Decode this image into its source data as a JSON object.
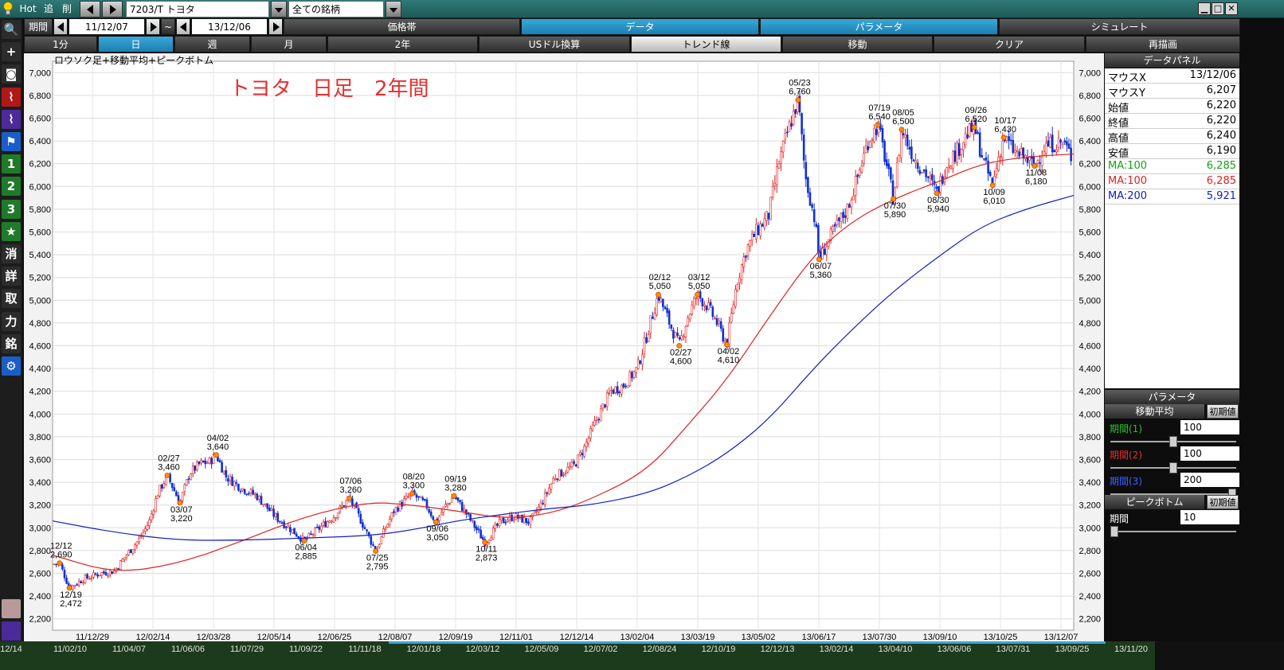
{
  "topbar": {
    "hot_label": "Hot",
    "add_label": "追",
    "del_label": "削",
    "symbol_value": "7203/T トヨタ",
    "universe_value": "全ての銘柄",
    "window_min": "▁",
    "window_max": "□",
    "window_close": "✕"
  },
  "period_row": {
    "period_label": "期間",
    "from_date": "11/12/07",
    "tilde": "~",
    "to_date": "13/12/06",
    "tabs": [
      "価格帯",
      "データ",
      "パラメータ",
      "シミュレート"
    ]
  },
  "span_row": {
    "tabs": [
      "1分",
      "日",
      "週",
      "月",
      "2年",
      "USドル換算",
      "トレンド線",
      "移動",
      "クリア",
      "再描画"
    ],
    "active_index": 1
  },
  "left_tools": [
    {
      "name": "zoom-icon",
      "glyph": "🔍",
      "style": "dark"
    },
    {
      "name": "crosshair-icon",
      "glyph": "+",
      "style": "dark"
    },
    {
      "name": "camera-icon",
      "glyph": "◙",
      "style": "dark"
    },
    {
      "name": "chart-line-icon",
      "glyph": "⌇",
      "style": "red"
    },
    {
      "name": "chart-multi-icon",
      "glyph": "⌇",
      "style": "purple"
    },
    {
      "name": "flag-icon",
      "glyph": "⚑",
      "style": "blue"
    },
    {
      "name": "preset-1-icon",
      "glyph": "1",
      "style": "green"
    },
    {
      "name": "preset-2-icon",
      "glyph": "2",
      "style": "green"
    },
    {
      "name": "preset-3-icon",
      "glyph": "3",
      "style": "green"
    },
    {
      "name": "star-icon",
      "glyph": "★",
      "style": "green"
    },
    {
      "name": "erase-icon",
      "glyph": "消",
      "style": "dark"
    },
    {
      "name": "detail-icon",
      "glyph": "詳",
      "style": "dark"
    },
    {
      "name": "take-icon",
      "glyph": "取",
      "style": "dark"
    },
    {
      "name": "power-icon",
      "glyph": "力",
      "style": "dark"
    },
    {
      "name": "stock-icon",
      "glyph": "銘",
      "style": "dark"
    },
    {
      "name": "settings-icon",
      "glyph": "⚙",
      "style": "blue"
    }
  ],
  "chart_header": {
    "label": "ロウソク足+移動平均+ピークボトム",
    "overlay_title": "トヨタ　日足　2年間"
  },
  "chart_data": {
    "type": "line",
    "title": "トヨタ　日足　2年間",
    "ylim": [
      2100,
      7100
    ],
    "yticks": [
      2200,
      2400,
      2600,
      2800,
      3000,
      3200,
      3400,
      3600,
      3800,
      4000,
      4200,
      4400,
      4600,
      4800,
      5000,
      5200,
      5400,
      5600,
      5800,
      6000,
      6200,
      6400,
      6600,
      6800,
      7000
    ],
    "x_tick_labels": [
      "11/12/29",
      "12/02/14",
      "12/03/28",
      "12/05/14",
      "12/06/25",
      "12/08/07",
      "12/09/19",
      "12/11/01",
      "12/12/14",
      "13/02/04",
      "13/03/19",
      "13/05/02",
      "13/06/17",
      "13/07/30",
      "13/09/10",
      "13/10/25",
      "13/12/07"
    ],
    "bottom_strip_labels": [
      "12/14",
      "11/02/10",
      "11/04/07",
      "11/06/06",
      "11/07/29",
      "11/09/22",
      "11/11/18",
      "12/01/18",
      "12/03/12",
      "12/05/09",
      "12/07/02",
      "12/08/24",
      "12/10/19",
      "12/12/13",
      "13/02/14",
      "13/04/10",
      "13/06/06",
      "13/07/31",
      "13/09/25",
      "13/11/20"
    ],
    "x_range": [
      "11/12/07",
      "13/12/06"
    ],
    "price_path": [
      [
        "11/12/07",
        2680
      ],
      [
        "11/12/12",
        2690
      ],
      [
        "11/12/19",
        2472
      ],
      [
        "11/12/29",
        2550
      ],
      [
        "12/01/10",
        2600
      ],
      [
        "12/01/20",
        2620
      ],
      [
        "12/01/30",
        2780
      ],
      [
        "12/02/07",
        2900
      ],
      [
        "12/02/14",
        3050
      ],
      [
        "12/02/20",
        3300
      ],
      [
        "12/02/27",
        3460
      ],
      [
        "12/03/07",
        3220
      ],
      [
        "12/03/14",
        3480
      ],
      [
        "12/03/21",
        3560
      ],
      [
        "12/03/28",
        3580
      ],
      [
        "12/04/02",
        3640
      ],
      [
        "12/04/09",
        3450
      ],
      [
        "12/04/20",
        3350
      ],
      [
        "12/05/01",
        3280
      ],
      [
        "12/05/14",
        3100
      ],
      [
        "12/05/24",
        3000
      ],
      [
        "12/06/04",
        2885
      ],
      [
        "12/06/15",
        3000
      ],
      [
        "12/06/25",
        3100
      ],
      [
        "12/07/06",
        3260
      ],
      [
        "12/07/13",
        3100
      ],
      [
        "12/07/25",
        2795
      ],
      [
        "12/08/01",
        3000
      ],
      [
        "12/08/07",
        3150
      ],
      [
        "12/08/20",
        3300
      ],
      [
        "12/08/30",
        3200
      ],
      [
        "12/09/06",
        3050
      ],
      [
        "12/09/12",
        3180
      ],
      [
        "12/09/19",
        3280
      ],
      [
        "12/09/28",
        3120
      ],
      [
        "12/10/11",
        2873
      ],
      [
        "12/10/22",
        3050
      ],
      [
        "12/11/01",
        3100
      ],
      [
        "12/11/12",
        3050
      ],
      [
        "12/11/20",
        3200
      ],
      [
        "12/11/30",
        3450
      ],
      [
        "12/12/07",
        3500
      ],
      [
        "12/12/14",
        3550
      ],
      [
        "12/12/21",
        3700
      ],
      [
        "12/12/28",
        3900
      ],
      [
        "13/01/09",
        4200
      ],
      [
        "13/01/18",
        4250
      ],
      [
        "13/01/28",
        4400
      ],
      [
        "13/02/04",
        4700
      ],
      [
        "13/02/12",
        5050
      ],
      [
        "13/02/20",
        4800
      ],
      [
        "13/02/27",
        4600
      ],
      [
        "13/03/05",
        4850
      ],
      [
        "13/03/12",
        5050
      ],
      [
        "13/03/19",
        4950
      ],
      [
        "13/03/26",
        4800
      ],
      [
        "13/04/02",
        4610
      ],
      [
        "13/04/09",
        5150
      ],
      [
        "13/04/16",
        5450
      ],
      [
        "13/04/23",
        5600
      ],
      [
        "13/05/02",
        5750
      ],
      [
        "13/05/09",
        6200
      ],
      [
        "13/05/16",
        6500
      ],
      [
        "13/05/23",
        6760
      ],
      [
        "13/05/28",
        6100
      ],
      [
        "13/06/04",
        5700
      ],
      [
        "13/06/07",
        5360
      ],
      [
        "13/06/17",
        5600
      ],
      [
        "13/06/27",
        5800
      ],
      [
        "13/07/05",
        6100
      ],
      [
        "13/07/12",
        6400
      ],
      [
        "13/07/19",
        6540
      ],
      [
        "13/07/25",
        6200
      ],
      [
        "13/07/30",
        5890
      ],
      [
        "13/08/05",
        6500
      ],
      [
        "13/08/14",
        6250
      ],
      [
        "13/08/23",
        6100
      ],
      [
        "13/08/30",
        5940
      ],
      [
        "13/09/06",
        6200
      ],
      [
        "13/09/13",
        6300
      ],
      [
        "13/09/20",
        6450
      ],
      [
        "13/09/26",
        6520
      ],
      [
        "13/10/03",
        6200
      ],
      [
        "13/10/09",
        6010
      ],
      [
        "13/10/14",
        6300
      ],
      [
        "13/10/17",
        6430
      ],
      [
        "13/10/25",
        6300
      ],
      [
        "13/11/01",
        6250
      ],
      [
        "13/11/08",
        6180
      ],
      [
        "13/11/15",
        6350
      ],
      [
        "13/11/22",
        6380
      ],
      [
        "13/11/29",
        6380
      ],
      [
        "13/12/06",
        6220
      ]
    ],
    "series": [
      {
        "name": "MA:100",
        "color": "#e02020",
        "values": [
          [
            "11/12/07",
            2760
          ],
          [
            "12/01/20",
            2600
          ],
          [
            "12/03/05",
            2680
          ],
          [
            "12/04/20",
            2880
          ],
          [
            "12/06/04",
            3100
          ],
          [
            "12/07/20",
            3230
          ],
          [
            "12/08/20",
            3200
          ],
          [
            "12/09/20",
            3150
          ],
          [
            "12/10/25",
            3080
          ],
          [
            "12/11/26",
            3120
          ],
          [
            "12/12/26",
            3250
          ],
          [
            "13/02/04",
            3500
          ],
          [
            "13/03/05",
            3900
          ],
          [
            "13/04/02",
            4300
          ],
          [
            "13/05/02",
            4850
          ],
          [
            "13/06/03",
            5400
          ],
          [
            "13/07/01",
            5700
          ],
          [
            "13/08/01",
            5900
          ],
          [
            "13/09/02",
            6050
          ],
          [
            "13/10/01",
            6200
          ],
          [
            "13/11/01",
            6260
          ],
          [
            "13/12/06",
            6285
          ]
        ]
      },
      {
        "name": "MA:200",
        "color": "#1020c0",
        "values": [
          [
            "11/12/07",
            3060
          ],
          [
            "12/01/20",
            2960
          ],
          [
            "12/03/05",
            2890
          ],
          [
            "12/04/20",
            2890
          ],
          [
            "12/06/04",
            2910
          ],
          [
            "12/07/20",
            2930
          ],
          [
            "12/08/20",
            2980
          ],
          [
            "12/09/20",
            3060
          ],
          [
            "12/10/25",
            3120
          ],
          [
            "12/11/26",
            3170
          ],
          [
            "12/12/26",
            3200
          ],
          [
            "13/02/04",
            3300
          ],
          [
            "13/03/05",
            3450
          ],
          [
            "13/04/02",
            3650
          ],
          [
            "13/05/02",
            3950
          ],
          [
            "13/06/03",
            4400
          ],
          [
            "13/07/01",
            4750
          ],
          [
            "13/08/01",
            5100
          ],
          [
            "13/09/02",
            5400
          ],
          [
            "13/10/01",
            5650
          ],
          [
            "13/11/01",
            5800
          ],
          [
            "13/12/06",
            5921
          ]
        ]
      }
    ],
    "peaks": [
      {
        "date": "11/12/12",
        "label": "12/12",
        "value": "2,690",
        "v": 2690,
        "pos": "above"
      },
      {
        "date": "11/12/19",
        "label": "12/19",
        "value": "2,472",
        "v": 2472,
        "pos": "below"
      },
      {
        "date": "12/02/27",
        "label": "02/27",
        "value": "3,460",
        "v": 3460,
        "pos": "above"
      },
      {
        "date": "12/03/07",
        "label": "03/07",
        "value": "3,220",
        "v": 3220,
        "pos": "below"
      },
      {
        "date": "12/04/02",
        "label": "04/02",
        "value": "3,640",
        "v": 3640,
        "pos": "above"
      },
      {
        "date": "12/06/04",
        "label": "06/04",
        "value": "2,885",
        "v": 2885,
        "pos": "below"
      },
      {
        "date": "12/07/06",
        "label": "07/06",
        "value": "3,260",
        "v": 3260,
        "pos": "above"
      },
      {
        "date": "12/07/25",
        "label": "07/25",
        "value": "2,795",
        "v": 2795,
        "pos": "below"
      },
      {
        "date": "12/08/20",
        "label": "08/20",
        "value": "3,300",
        "v": 3300,
        "pos": "above"
      },
      {
        "date": "12/09/06",
        "label": "09/06",
        "value": "3,050",
        "v": 3050,
        "pos": "below"
      },
      {
        "date": "12/09/19",
        "label": "09/19",
        "value": "3,280",
        "v": 3280,
        "pos": "above"
      },
      {
        "date": "12/10/11",
        "label": "10/11",
        "value": "2,873",
        "v": 2873,
        "pos": "below"
      },
      {
        "date": "13/02/12",
        "label": "02/12",
        "value": "5,050",
        "v": 5050,
        "pos": "above"
      },
      {
        "date": "13/02/27",
        "label": "02/27",
        "value": "4,600",
        "v": 4600,
        "pos": "below"
      },
      {
        "date": "13/03/12",
        "label": "03/12",
        "value": "5,050",
        "v": 5050,
        "pos": "above"
      },
      {
        "date": "13/04/02",
        "label": "04/02",
        "value": "4,610",
        "v": 4610,
        "pos": "below"
      },
      {
        "date": "13/05/23",
        "label": "05/23",
        "value": "6,760",
        "v": 6760,
        "pos": "above"
      },
      {
        "date": "13/06/07",
        "label": "06/07",
        "value": "5,360",
        "v": 5360,
        "pos": "below"
      },
      {
        "date": "13/07/19",
        "label": "07/19",
        "value": "6,540",
        "v": 6540,
        "pos": "above"
      },
      {
        "date": "13/07/30",
        "label": "07/30",
        "value": "5,890",
        "v": 5890,
        "pos": "below"
      },
      {
        "date": "13/08/05",
        "label": "08/05",
        "value": "6,500",
        "v": 6500,
        "pos": "above"
      },
      {
        "date": "13/08/30",
        "label": "08/30",
        "value": "5,940",
        "v": 5940,
        "pos": "below"
      },
      {
        "date": "13/09/26",
        "label": "09/26",
        "value": "6,520",
        "v": 6520,
        "pos": "above"
      },
      {
        "date": "13/10/09",
        "label": "10/09",
        "value": "6,010",
        "v": 6010,
        "pos": "below"
      },
      {
        "date": "13/10/17",
        "label": "10/17",
        "value": "6,430",
        "v": 6430,
        "pos": "above"
      },
      {
        "date": "13/11/08",
        "label": "11/08",
        "value": "6,180",
        "v": 6180,
        "pos": "below"
      }
    ],
    "up_color": "#e02020",
    "down_color": "#1030d0",
    "peak_marker_color": "#ff8c00",
    "grid": true,
    "axis_side": "right"
  },
  "data_panel": {
    "title": "データパネル",
    "rows": [
      {
        "k": "マウスX",
        "v": "13/12/06",
        "color": "#000000"
      },
      {
        "k": "マウスY",
        "v": "6,207",
        "color": "#000000"
      },
      {
        "k": "始値",
        "v": "6,220",
        "color": "#000000"
      },
      {
        "k": "終値",
        "v": "6,220",
        "color": "#000000"
      },
      {
        "k": "高値",
        "v": "6,240",
        "color": "#000000"
      },
      {
        "k": "安値",
        "v": "6,190",
        "color": "#000000"
      },
      {
        "k": "MA:100",
        "v": "6,285",
        "color": "#14a014"
      },
      {
        "k": "MA:100",
        "v": "6,285",
        "color": "#e02020"
      },
      {
        "k": "MA:200",
        "v": "5,921",
        "color": "#1020c0"
      }
    ]
  },
  "param_panel": {
    "title": "パラメータ",
    "ma_section": "移動平均",
    "reset_label": "初期値",
    "ma_params": [
      {
        "label": "期間(1)",
        "value": "100",
        "color": "#2ec02e",
        "slider": 0.5
      },
      {
        "label": "期間(2)",
        "value": "100",
        "color": "#e03030",
        "slider": 0.5
      },
      {
        "label": "期間(3)",
        "value": "200",
        "color": "#4060ff",
        "slider": 1.0
      }
    ],
    "pb_section": "ピークボトム",
    "pb_param": {
      "label": "期間",
      "value": "10",
      "color": "#ffffff",
      "slider": 0.0
    }
  }
}
